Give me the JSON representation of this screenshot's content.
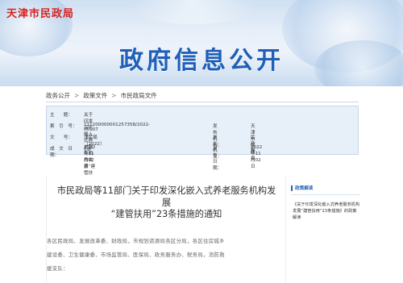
{
  "header": {
    "site_name": "天津市民政局",
    "banner_title": "政府信息公开"
  },
  "breadcrumb": [
    "政务公开",
    "政策文件",
    "市民政局文件"
  ],
  "breadcrumb_sep": ">",
  "info": {
    "index_label": "索　引　号：",
    "index_value": "111200000001257358/2022-00107",
    "doc_label": "文　　号：",
    "doc_value": "津民局〔2022〕5号",
    "issue_date_label": "成　文　日　期：",
    "issue_date_value": "2022年11月02日",
    "subject_label": "主　　题：",
    "subject_value": "关于印发深化嵌入式养老服务机构发展“建管扶用”23条措施",
    "publisher_label": "发　布　机　构：",
    "publisher_value": "天津市民政局",
    "issuer_label": "发　文　机　关：",
    "issuer_value": "民政局",
    "pub_date_label": "发　布　日　期：",
    "pub_date_value": "2022年11月02日"
  },
  "document": {
    "title_line1": "市民政局等11部门关于印发深化嵌入式养老服务机构发",
    "title_line2": "展",
    "title_line3": "“建管扶用”23条措施的通知",
    "body_line1": "各区民政局、发展改革委、财政局，市规划资源局各区分局，各区住房城乡",
    "body_line2": "建设委、卫生健康委、市场监管局、医保局、政务服务办、税务局，消防救",
    "body_line3": "援支队："
  },
  "sidebar": {
    "heading": "政策解读",
    "item": "《关于印发深化嵌入式养老服务机构发展“建管扶用”23条措施》的政策解读"
  }
}
